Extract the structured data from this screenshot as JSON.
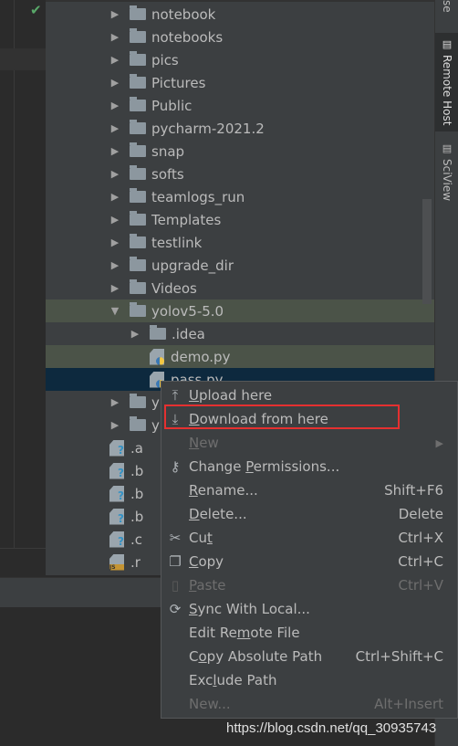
{
  "tool_windows": [
    {
      "label": "se",
      "icon": "list-icon"
    },
    {
      "label": "Remote Host",
      "icon": "server-icon",
      "active": true
    },
    {
      "label": "SciView",
      "icon": "grid-icon"
    }
  ],
  "tree": [
    {
      "name": "notebook",
      "type": "folder"
    },
    {
      "name": "notebooks",
      "type": "folder"
    },
    {
      "name": "pics",
      "type": "folder"
    },
    {
      "name": "Pictures",
      "type": "folder"
    },
    {
      "name": "Public",
      "type": "folder"
    },
    {
      "name": "pycharm-2021.2",
      "type": "folder"
    },
    {
      "name": "snap",
      "type": "folder"
    },
    {
      "name": "softs",
      "type": "folder"
    },
    {
      "name": "teamlogs_run",
      "type": "folder"
    },
    {
      "name": "Templates",
      "type": "folder"
    },
    {
      "name": "testlink",
      "type": "folder"
    },
    {
      "name": "upgrade_dir",
      "type": "folder"
    },
    {
      "name": "Videos",
      "type": "folder"
    },
    {
      "name": "yolov5-5.0",
      "type": "folder",
      "expanded": true,
      "state": "selected"
    },
    {
      "name": ".idea",
      "type": "folder",
      "depth": 1
    },
    {
      "name": "demo.py",
      "type": "py",
      "depth": 1,
      "state": "selected"
    },
    {
      "name": "pass.py",
      "type": "py",
      "depth": 1,
      "state": "focused"
    },
    {
      "name": "y",
      "type": "folder"
    },
    {
      "name": "y",
      "type": "folder"
    },
    {
      "name": ".a",
      "type": "unknown"
    },
    {
      "name": ".b",
      "type": "unknown"
    },
    {
      "name": ".b",
      "type": "unknown"
    },
    {
      "name": ".b",
      "type": "unknown"
    },
    {
      "name": ".c",
      "type": "unknown"
    },
    {
      "name": ".r",
      "type": "js"
    }
  ],
  "menu": {
    "items": [
      {
        "pre": "",
        "u": "U",
        "post": "pload here",
        "icon": "upload-icon",
        "glyph": "⤒"
      },
      {
        "pre": "",
        "u": "D",
        "post": "ownload from here",
        "icon": "download-icon",
        "glyph": "⤓",
        "highlighted": true
      },
      {
        "pre": "",
        "u": "N",
        "post": "ew",
        "disabled": true,
        "submenu": true
      },
      {
        "pre": "Change ",
        "u": "P",
        "post": "ermissions...",
        "icon": "key-icon",
        "glyph": "⚷"
      },
      {
        "pre": "",
        "u": "R",
        "post": "ename...",
        "shortcut": "Shift+F6"
      },
      {
        "pre": "",
        "u": "D",
        "post": "elete...",
        "shortcut": "Delete"
      },
      {
        "pre": "Cu",
        "u": "t",
        "post": "",
        "icon": "scissors-icon",
        "glyph": "✂",
        "shortcut": "Ctrl+X"
      },
      {
        "pre": "",
        "u": "C",
        "post": "opy",
        "icon": "copy-icon",
        "glyph": "❐",
        "shortcut": "Ctrl+C"
      },
      {
        "pre": "",
        "u": "P",
        "post": "aste",
        "icon": "paste-icon",
        "glyph": "▯",
        "shortcut": "Ctrl+V",
        "disabled": true
      },
      {
        "pre": "",
        "u": "S",
        "post": "ync With Local...",
        "icon": "sync-icon",
        "glyph": "⟳"
      },
      {
        "pre": "Edit Re",
        "u": "m",
        "post": "ote File"
      },
      {
        "pre": "C",
        "u": "o",
        "post": "py Absolute Path",
        "shortcut": "Ctrl+Shift+C"
      },
      {
        "pre": "Exc",
        "u": "l",
        "post": "ude Path"
      },
      {
        "pre": "New...",
        "u": "",
        "post": "",
        "shortcut": "Alt+Insert",
        "disabled": true
      }
    ]
  },
  "watermark": "https://blog.csdn.net/qq_30935743",
  "colors": {
    "highlight_box": "#e53030",
    "selected_row": "#4b5348",
    "focused_row": "#0d293e",
    "check": "#59a869"
  }
}
